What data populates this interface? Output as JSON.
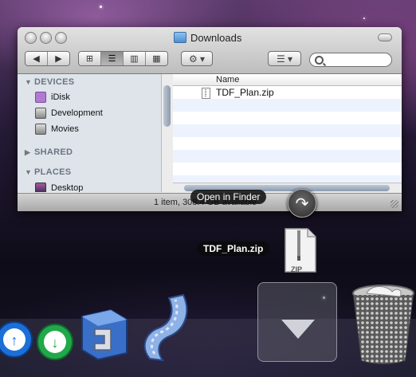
{
  "window": {
    "title": "Downloads",
    "search_placeholder": "",
    "toolbar": {
      "view_icons": [
        "icon-view-icon",
        "list-view-icon",
        "column-view-icon",
        "coverflow-view-icon"
      ],
      "active_view": "list-view-icon"
    }
  },
  "sidebar": {
    "devices": {
      "label": "DEVICES",
      "items": [
        {
          "label": "iDisk"
        },
        {
          "label": "Development"
        },
        {
          "label": "Movies"
        }
      ]
    },
    "shared": {
      "label": "SHARED"
    },
    "places": {
      "label": "PLACES",
      "items": [
        {
          "label": "Desktop"
        }
      ]
    }
  },
  "list": {
    "column_name": "Name",
    "files": [
      {
        "name": "TDF_Plan.zip"
      }
    ]
  },
  "status": {
    "text": "1 item, 308.4 GB available"
  },
  "overlay": {
    "open_in_finder": "Open in Finder",
    "dragged_file_label": "TDF_Plan.zip",
    "zip_badge": "ZIP"
  },
  "colors": {
    "selection_row": "#edf3fe",
    "sidebar_bg": "#dee4ea"
  }
}
